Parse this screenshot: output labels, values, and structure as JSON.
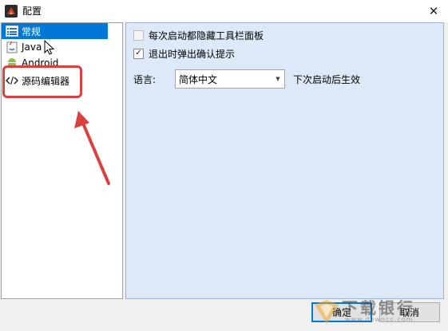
{
  "window": {
    "title": "配置",
    "close_glyph": "✕"
  },
  "sidebar": {
    "items": [
      {
        "label": "常规",
        "icon": "list-settings-icon",
        "selected": true
      },
      {
        "label": "Java",
        "icon": "java-icon",
        "selected": false
      },
      {
        "label": "Android",
        "icon": "android-icon",
        "selected": false
      },
      {
        "label": "源码编辑器",
        "icon": "code-icon",
        "selected": false
      }
    ]
  },
  "settings": {
    "hide_toolbar": {
      "label": "每次启动都隐藏工具栏面板",
      "checked": false
    },
    "confirm_exit": {
      "label": "退出时弹出确认提示",
      "checked": true,
      "check_glyph": "✓"
    },
    "language": {
      "label": "语言:",
      "value": "简体中文",
      "note": "下次启动后生效",
      "arrow_glyph": "▼"
    }
  },
  "buttons": {
    "ok_label": "确定",
    "cancel_label": "取消"
  },
  "watermark": {
    "text": "下载银行",
    "url": "www.downcc.com"
  },
  "colors": {
    "selection": "#0078d7",
    "panel": "#dde9f8",
    "annotation": "#d9413f"
  }
}
